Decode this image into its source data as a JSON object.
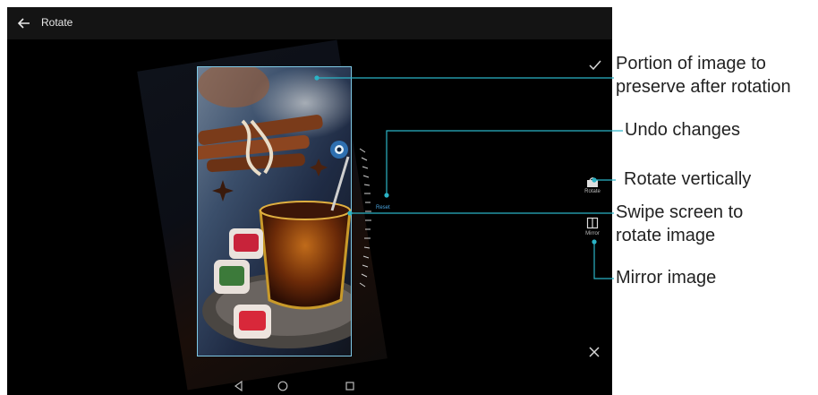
{
  "app": {
    "title": "Rotate"
  },
  "icons": {
    "back": "arrow-left-icon",
    "confirm": "check-icon",
    "cancel": "close-icon",
    "rotate": "rotate-icon",
    "mirror": "mirror-icon",
    "nav_back": "triangle-back-icon",
    "nav_home": "circle-home-icon",
    "nav_recent": "square-recent-icon"
  },
  "toolbar": {
    "rotate_label": "Rotate",
    "mirror_label": "Mirror",
    "reset_label": "Reset"
  },
  "callouts": {
    "portion_line1": "Portion of image to",
    "portion_line2": "preserve after rotation",
    "undo": "Undo changes",
    "rotate_vertically": "Rotate vertically",
    "swipe_line1": "Swipe screen to",
    "swipe_line2": "rotate image",
    "mirror": "Mirror image"
  },
  "colors": {
    "accent": "#2bb3c6",
    "frame": "#7fc9e6",
    "reset": "#4aa6e0"
  }
}
